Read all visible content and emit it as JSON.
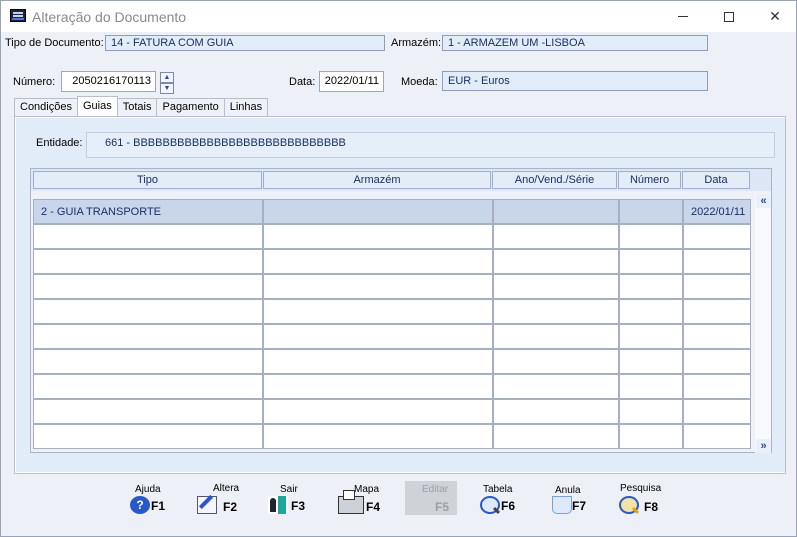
{
  "window": {
    "title": "Alteração do Documento"
  },
  "header": {
    "tipo_label": "Tipo de Documento:",
    "tipo_value": "14 - FATURA COM GUIA",
    "armazem_label": "Armazém:",
    "armazem_value": "1 - ARMAZEM UM -LISBOA",
    "numero_label": "Número:",
    "numero_value": "2050216170113",
    "data_label": "Data:",
    "data_value": "2022/01/11",
    "moeda_label": "Moeda:",
    "moeda_value": "EUR - Euros"
  },
  "tabs": [
    {
      "label": "Condições"
    },
    {
      "label": "Guias",
      "active": true
    },
    {
      "label": "Totais"
    },
    {
      "label": "Pagamento"
    },
    {
      "label": "Linhas"
    }
  ],
  "guias": {
    "entidade_label": "Entidade:",
    "entidade_value": "661 - BBBBBBBBBBBBBBBBBBBBBBBBBBBBB",
    "columns": [
      "Tipo",
      "Armazém",
      "Ano/Vend./Série",
      "Número",
      "Data"
    ],
    "rows": [
      {
        "tipo": "2 - GUIA TRANSPORTE",
        "armazem": "",
        "ano": "",
        "numero": "",
        "data": "2022/01/11"
      }
    ]
  },
  "footer": {
    "buttons": [
      {
        "label": "Ajuda",
        "key": "F1",
        "icon": "help-icon"
      },
      {
        "label": "Altera",
        "key": "F2",
        "icon": "edit-icon"
      },
      {
        "label": "Sair",
        "key": "F3",
        "icon": "exit-icon"
      },
      {
        "label": "Mapa",
        "key": "F4",
        "icon": "printer-icon"
      },
      {
        "label": "Editar",
        "key": "F5",
        "icon": "disabled-icon",
        "disabled": true
      },
      {
        "label": "Tabela",
        "key": "F6",
        "icon": "table-search-icon"
      },
      {
        "label": "Anula",
        "key": "F7",
        "icon": "cancel-icon"
      },
      {
        "label": "Pesquisa",
        "key": "F8",
        "icon": "search-icon"
      }
    ]
  }
}
